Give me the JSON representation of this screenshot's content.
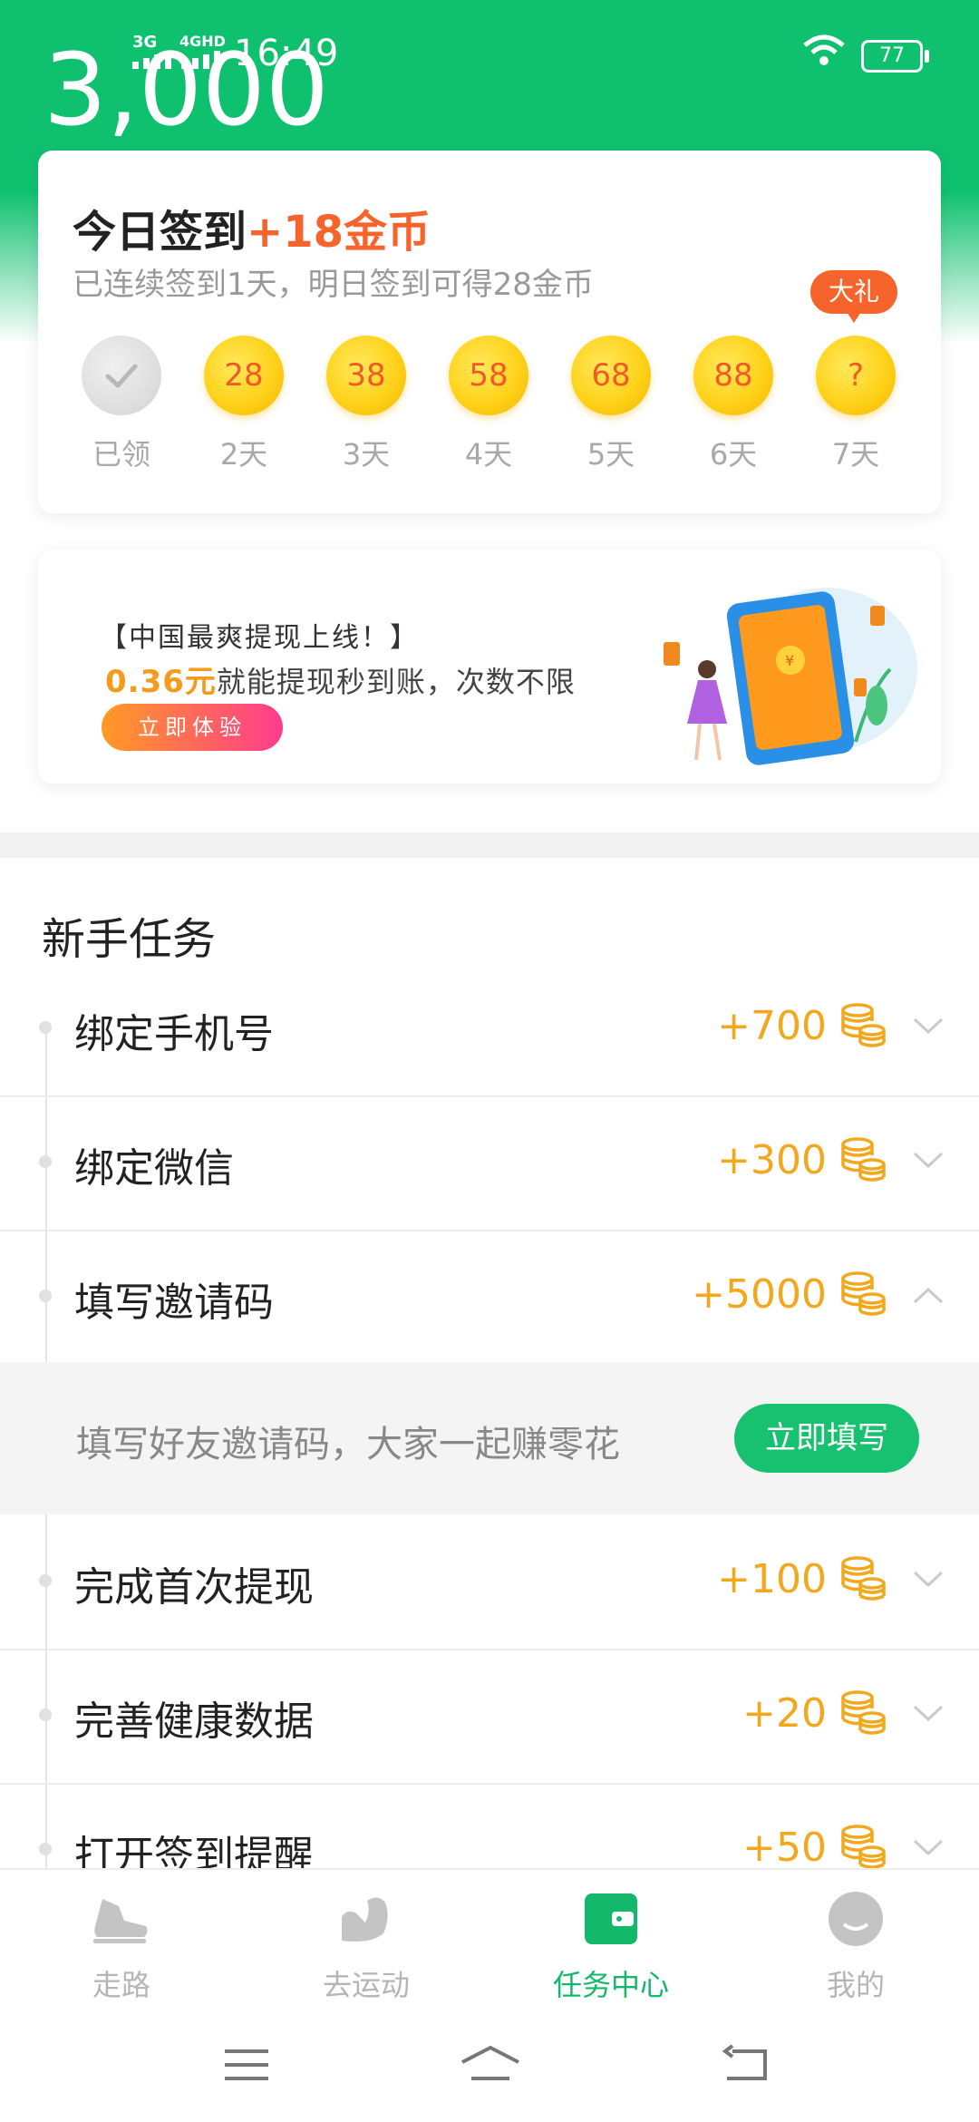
{
  "status_bar": {
    "signal1": "3G",
    "signal2": "4GHD",
    "time": "16:49",
    "battery": "77"
  },
  "header": {
    "points_partial": "3,000"
  },
  "checkin": {
    "title": "今日签到",
    "bonus": "+18金币",
    "subtitle": "已连续签到1天，明日签到可得28金币",
    "gift_badge": "大礼",
    "days": [
      {
        "value": "",
        "label": "已领",
        "done": true
      },
      {
        "value": "28",
        "label": "2天"
      },
      {
        "value": "38",
        "label": "3天"
      },
      {
        "value": "58",
        "label": "4天"
      },
      {
        "value": "68",
        "label": "5天"
      },
      {
        "value": "88",
        "label": "6天"
      },
      {
        "value": "?",
        "label": "7天"
      }
    ]
  },
  "banner": {
    "line1": "【中国最爽提现上线！】",
    "amount": "0.36元",
    "line2_rest": "就能提现秒到账，次数不限",
    "button": "立即体验"
  },
  "section": {
    "title": "新手任务"
  },
  "tasks": [
    {
      "name": "绑定手机号",
      "reward": "+700"
    },
    {
      "name": "绑定微信",
      "reward": "+300"
    },
    {
      "name": "填写邀请码",
      "reward": "+5000"
    },
    {
      "name": "完成首次提现",
      "reward": "+100"
    },
    {
      "name": "完善健康数据",
      "reward": "+20"
    },
    {
      "name": "打开签到提醒",
      "reward": "+50"
    }
  ],
  "invite_expand": {
    "text": "填写好友邀请码，大家一起赚零花",
    "button": "立即填写"
  },
  "tabbar": {
    "tabs": [
      {
        "label": "走路"
      },
      {
        "label": "去运动"
      },
      {
        "label": "任务中心"
      },
      {
        "label": "我的"
      }
    ]
  },
  "colors": {
    "brand_green": "#0fc16f",
    "accent_orange": "#f6642c",
    "reward_gold": "#f2a81c",
    "active_tab": "#14b86a"
  }
}
